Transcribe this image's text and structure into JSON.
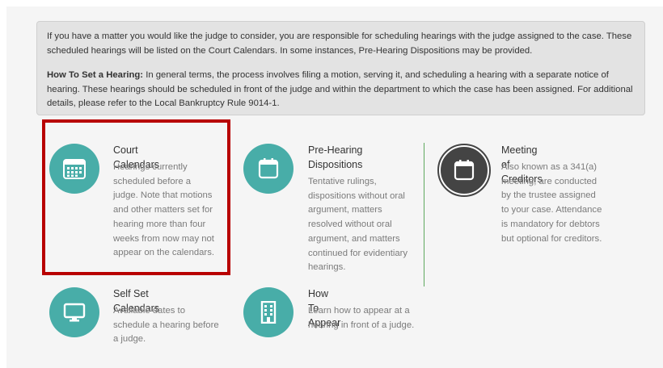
{
  "notice": {
    "para1": "If you have a matter you would like the judge to consider, you are responsible for scheduling hearings with the judge assigned to the case. These scheduled hearings will be listed on the Court Calendars. In some instances, Pre-Hearing Dispositions may be provided.",
    "para2_label": "How To Set a Hearing:",
    "para2_text": " In general terms, the process involves filing a motion, serving it, and scheduling a hearing with a separate notice of hearing. These hearings should be scheduled in front of the judge and within the department to which the case has been assigned. For additional details, please refer to the Local Bankruptcy Rule 9014-1."
  },
  "cards": {
    "court_calendars": {
      "title": "Court Calendars",
      "desc": "Hearings currently scheduled before a judge. Note that motions and other matters set for hearing more than four weeks from now may not appear on the calendars.",
      "icon": "calendar-grid-icon"
    },
    "pre_hearing": {
      "title": "Pre-Hearing Dispositions",
      "desc": "Tentative rulings, dispositions without oral argument, matters resolved without oral argument, and matters continued for evidentiary hearings.",
      "icon": "calendar-blank-icon"
    },
    "meeting_creditors": {
      "title": "Meeting of Creditors",
      "desc": "Also known as a 341(a) meeting, are conducted by the trustee assigned to your case. Attendance is mandatory for debtors but optional for creditors.",
      "icon": "calendar-dark-icon"
    },
    "self_set": {
      "title": "Self Set Calendars",
      "desc": "Available dates to schedule a hearing before a judge.",
      "icon": "monitor-icon"
    },
    "how_to_appear": {
      "title": "How To Appear",
      "desc": "Learn how to appear at a hearing in front of a judge.",
      "icon": "building-icon"
    }
  },
  "colors": {
    "teal": "#48ada8",
    "dark": "#444444",
    "highlight": "#b80000",
    "divider": "#5ea85e"
  }
}
